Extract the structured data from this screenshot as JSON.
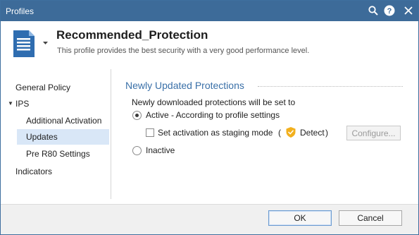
{
  "window": {
    "title": "Profiles",
    "icons": [
      "search-icon",
      "help-icon",
      "close-icon"
    ]
  },
  "header": {
    "profile_name": "Recommended_Protection",
    "profile_description": "This profile provides the best security with a very good performance level."
  },
  "sidebar": {
    "items": [
      {
        "label": "General Policy",
        "selected": false
      },
      {
        "label": "IPS",
        "expanded": true,
        "selected": false
      },
      {
        "label": "Additional Activation",
        "selected": false
      },
      {
        "label": "Updates",
        "selected": true
      },
      {
        "label": "Pre R80 Settings",
        "selected": false
      },
      {
        "label": "Indicators",
        "selected": false
      }
    ]
  },
  "main": {
    "section_title": "Newly Updated Protections",
    "intro": "Newly downloaded protections will be set to",
    "options": {
      "active": {
        "label": "Active - According to profile settings",
        "checked": true
      },
      "staging": {
        "label": "Set activation as staging mode",
        "checked": false
      },
      "inactive": {
        "label": "Inactive",
        "checked": false
      }
    },
    "staging_detail": {
      "open_paren": "(",
      "mode_label": "Detect",
      "close_paren": ")",
      "icon": "shield-icon"
    },
    "configure_button": "Configure..."
  },
  "footer": {
    "ok_label": "OK",
    "cancel_label": "Cancel"
  },
  "colors": {
    "titlebar": "#3d6b99",
    "accent": "#3a70a8",
    "selection": "#d9e7f7",
    "detect_shield": "#f2b01e"
  }
}
